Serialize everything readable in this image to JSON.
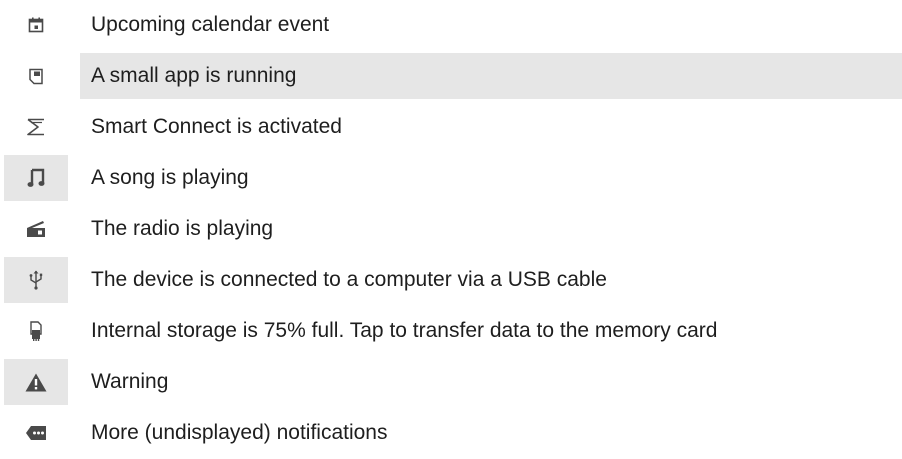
{
  "rows": [
    {
      "icon": "calendar-icon",
      "text": "Upcoming calendar event",
      "icon_shaded": false,
      "text_shaded": false
    },
    {
      "icon": "small-app-icon",
      "text": "A small app is running",
      "icon_shaded": false,
      "text_shaded": true
    },
    {
      "icon": "smart-connect-icon",
      "text": "Smart Connect is activated",
      "icon_shaded": false,
      "text_shaded": false
    },
    {
      "icon": "music-note-icon",
      "text": "A song is playing",
      "icon_shaded": true,
      "text_shaded": false
    },
    {
      "icon": "radio-icon",
      "text": "The radio is playing",
      "icon_shaded": false,
      "text_shaded": false
    },
    {
      "icon": "usb-icon",
      "text": "The device is connected to a computer via a USB cable",
      "icon_shaded": true,
      "text_shaded": false
    },
    {
      "icon": "storage-icon",
      "text": "Internal storage is 75% full. Tap to transfer data to the memory card",
      "icon_shaded": false,
      "text_shaded": false
    },
    {
      "icon": "warning-icon",
      "text": "Warning",
      "icon_shaded": true,
      "text_shaded": false
    },
    {
      "icon": "more-notifications-icon",
      "text": "More (undisplayed) notifications",
      "icon_shaded": false,
      "text_shaded": false
    }
  ],
  "colors": {
    "text": "#1e1e1e",
    "icon": "#4a4a4a",
    "shade": "#e6e6e6"
  }
}
